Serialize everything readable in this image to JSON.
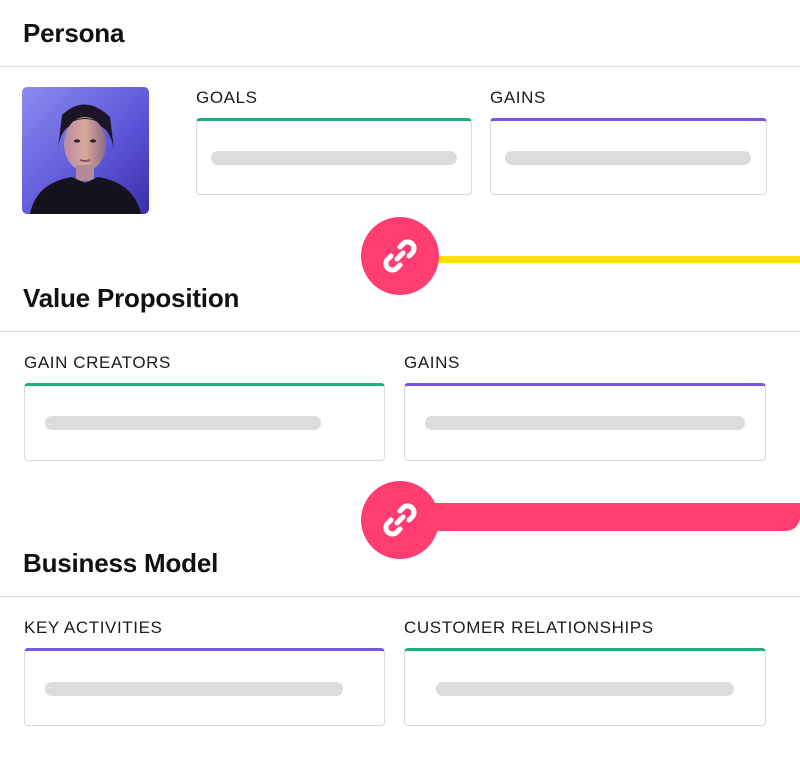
{
  "colors": {
    "green_accent": "#1cb07f",
    "purple_accent": "#7a55e0",
    "link_pink": "#ff3d71",
    "link_yellow": "#ffe000"
  },
  "persona": {
    "title": "Persona",
    "avatar_icon": "person-photo",
    "goals_label": "GOALS",
    "gains_label": "GAINS"
  },
  "value_proposition": {
    "title": "Value Proposition",
    "gain_creators_label": "GAIN CREATORS",
    "gains_label": "GAINS"
  },
  "business_model": {
    "title": "Business Model",
    "key_activities_label": "KEY ACTIVITIES",
    "customer_relationships_label": "CUSTOMER RELATIONSHIPS"
  },
  "links": {
    "icon": "chain-link-icon",
    "first_line_color": "#ffe000",
    "second_line_color": "#ff3d71"
  }
}
